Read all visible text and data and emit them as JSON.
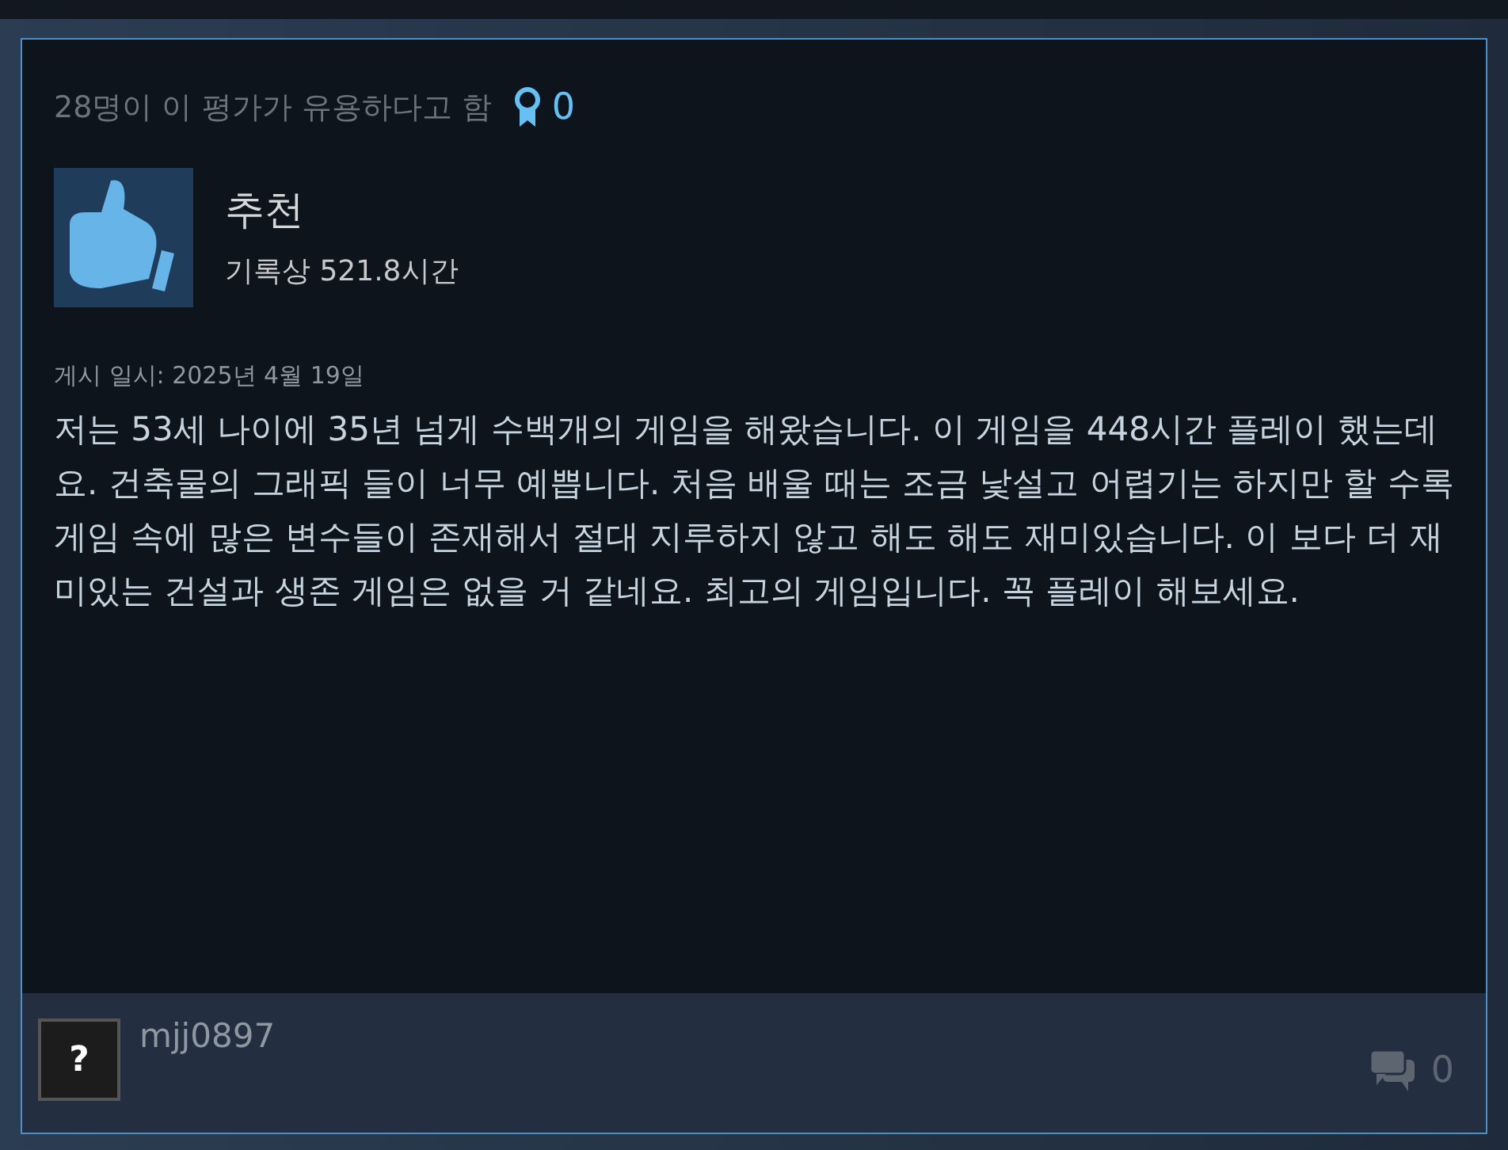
{
  "helpful": "28명이 이 평가가 유용하다고 함",
  "awards": "0",
  "verdict": "추천",
  "hours": "기록상 521.8시간",
  "posted": "게시 일시: 2025년 4월 19일",
  "body": "저는 53세 나이에 35년 넘게 수백개의 게임을 해왔습니다. 이 게임을 448시간 플레이 했는데요. 건축물의 그래픽 들이 너무 예쁩니다. 처음 배울 때는 조금 낯설고 어렵기는 하지만 할 수록 게임 속에 많은 변수들이 존재해서 절대 지루하지 않고 해도 해도 재미있습니다. 이 보다 더 재미있는 건설과 생존 게임은 없을 거 같네요. 최고의 게임입니다. 꼭 플레이 해보세요.",
  "author": {
    "avatar": "?",
    "name": "mjj0897"
  },
  "comments": "0"
}
